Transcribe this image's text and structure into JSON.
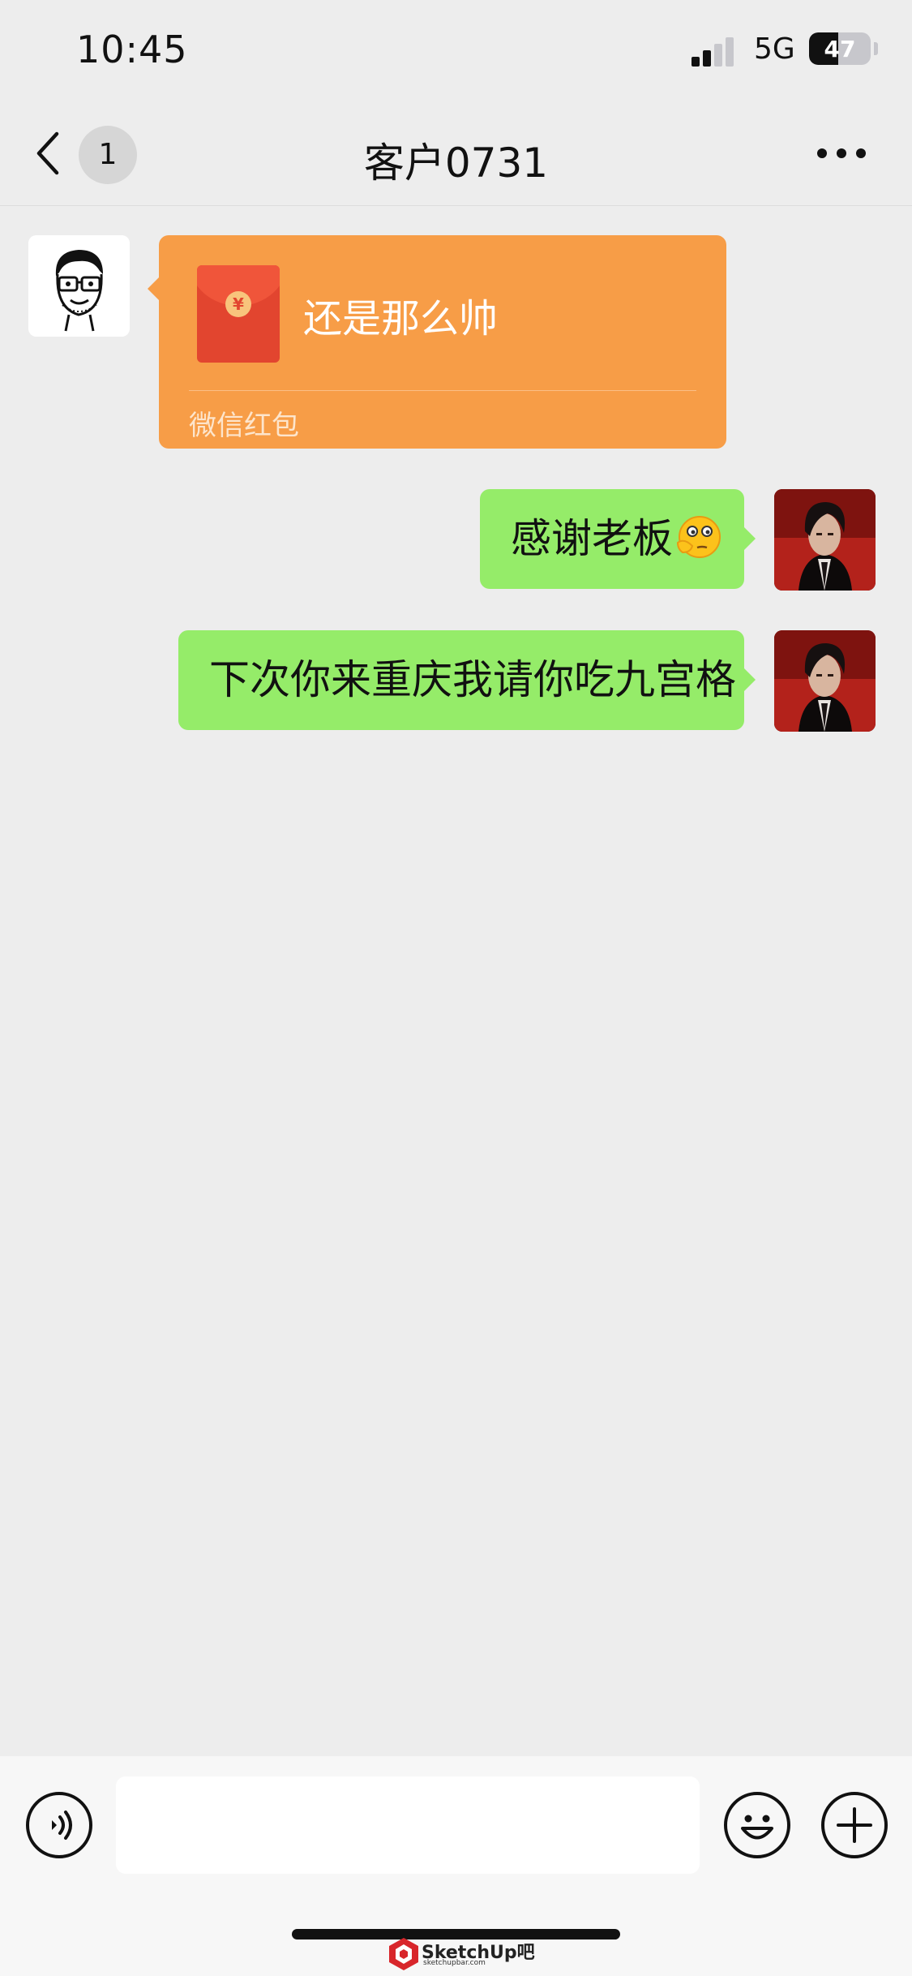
{
  "status_bar": {
    "time": "10:45",
    "network": "5G",
    "battery_level": "47",
    "battery_fraction": 0.47,
    "signal_bars_active": 2,
    "signal_bars_total": 4
  },
  "nav": {
    "title": "客户0731",
    "unread_count": "1",
    "back_icon": "chevron-left-icon",
    "more_icon": "more-dots-icon"
  },
  "messages": [
    {
      "sender": "contact",
      "type": "red_packet",
      "text": "还是那么帅",
      "label": "微信红包",
      "icon": "red-envelope-icon"
    },
    {
      "sender": "self",
      "type": "text",
      "text": "感谢老板",
      "emoji": "thinking-face-emoji"
    },
    {
      "sender": "self",
      "type": "text",
      "text": "下次你来重庆我请你吃九宫格"
    }
  ],
  "input_bar": {
    "placeholder": "",
    "voice_icon": "voice-icon",
    "emoji_icon": "smiley-icon",
    "plus_icon": "plus-icon"
  },
  "watermark": {
    "brand": "SketchUp吧",
    "url": "sketchupbar.com"
  },
  "colors": {
    "background": "#ededed",
    "self_bubble": "#95ec69",
    "red_packet": "#f79d47",
    "envelope": "#e2452f"
  }
}
